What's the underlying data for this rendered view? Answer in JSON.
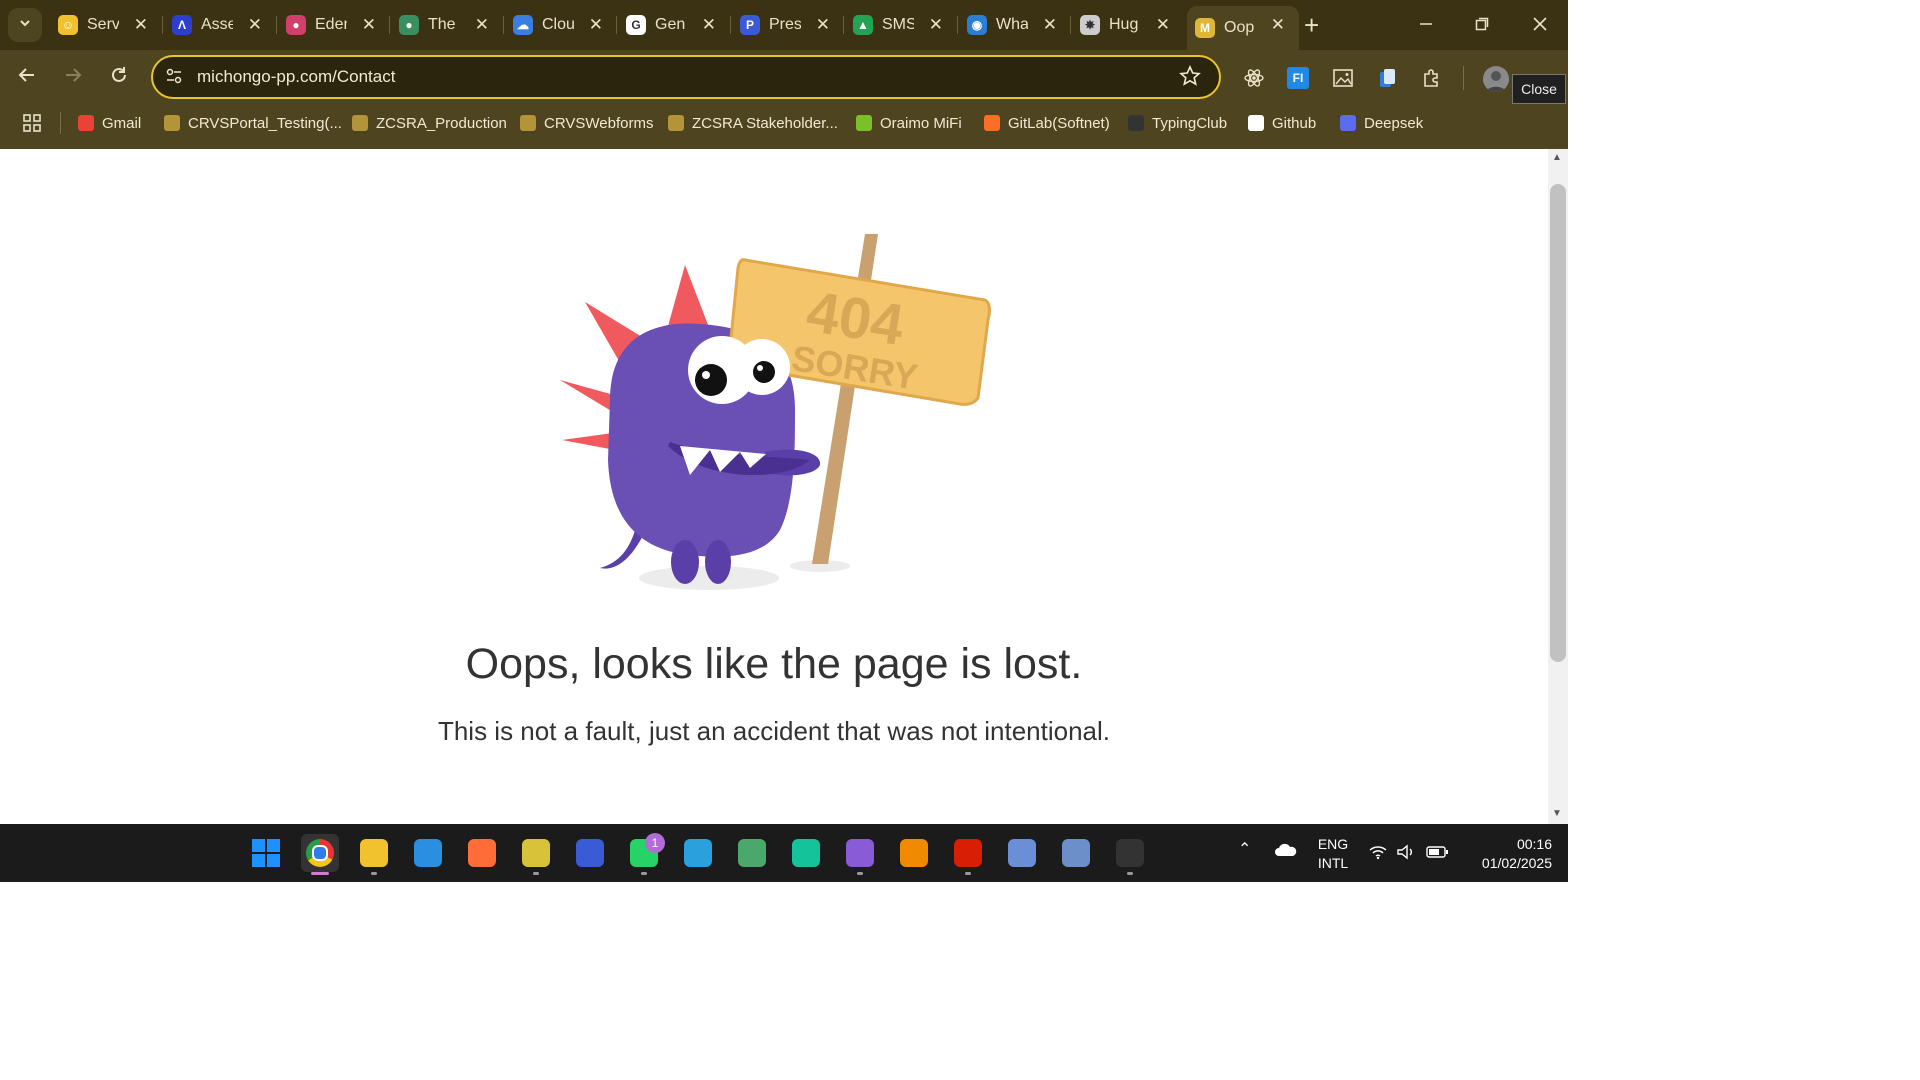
{
  "tabs": [
    {
      "title": "Serv",
      "fav_color": "#f2c12e",
      "fav_glyph": "☺"
    },
    {
      "title": "Asse",
      "fav_color": "#2d3fcf",
      "fav_glyph": "Λ"
    },
    {
      "title": "Eden",
      "fav_color": "#d23f6c",
      "fav_glyph": "●"
    },
    {
      "title": "The",
      "fav_color": "#3a8f61",
      "fav_glyph": "●"
    },
    {
      "title": "Clou",
      "fav_color": "#3a7ee0",
      "fav_glyph": "☁"
    },
    {
      "title": "Gen",
      "fav_color": "#ffffff",
      "fav_glyph": "G"
    },
    {
      "title": "Pres",
      "fav_color": "#3b5bd6",
      "fav_glyph": "P"
    },
    {
      "title": "SMS",
      "fav_color": "#23a455",
      "fav_glyph": "▲"
    },
    {
      "title": "Wha",
      "fav_color": "#2a7fd4",
      "fav_glyph": "◉"
    },
    {
      "title": "Hug",
      "fav_color": "#cccccc",
      "fav_glyph": "✸"
    },
    {
      "title": "Oop",
      "fav_color": "#e0b63a",
      "fav_glyph": "M"
    }
  ],
  "address": {
    "url": "michongo-pp.com/Contact"
  },
  "bookmarks": [
    {
      "label": "Gmail",
      "color": "#ea4335"
    },
    {
      "label": "CRVSPortal_Testing(...",
      "color": "#b3943a"
    },
    {
      "label": "ZCSRA_Production",
      "color": "#b3943a"
    },
    {
      "label": "CRVSWebforms",
      "color": "#b3943a"
    },
    {
      "label": "ZCSRA Stakeholder...",
      "color": "#b3943a"
    },
    {
      "label": "Oraimo MiFi",
      "color": "#7bbf2a"
    },
    {
      "label": "GitLab(Softnet)",
      "color": "#fc6d26"
    },
    {
      "label": "TypingClub",
      "color": "#333333"
    },
    {
      "label": "Github",
      "color": "#ffffff"
    },
    {
      "label": "Deepsek",
      "color": "#5b6cf0"
    }
  ],
  "tooltip": "Close",
  "page": {
    "sign_line1": "404",
    "sign_line2": "SORRY",
    "headline": "Oops, looks like the page is lost.",
    "subline": "This is not a fault, just an accident that was not intentional."
  },
  "taskbar": {
    "apps": [
      {
        "name": "windows-start",
        "color": "#1e90ff"
      },
      {
        "name": "chrome",
        "color": "#e44"
      },
      {
        "name": "file-explorer",
        "color": "#f2c12e"
      },
      {
        "name": "vscode",
        "color": "#2a8fe0"
      },
      {
        "name": "postman",
        "color": "#ff6c37"
      },
      {
        "name": "editor",
        "color": "#d8c23a"
      },
      {
        "name": "azure-data-studio",
        "color": "#3a5bd6"
      },
      {
        "name": "whatsapp",
        "color": "#25d366"
      },
      {
        "name": "telegram",
        "color": "#2aa0dc"
      },
      {
        "name": "globe",
        "color": "#4aa86c"
      },
      {
        "name": "grammarly",
        "color": "#15c39a"
      },
      {
        "name": "visual-studio",
        "color": "#8a5bd6"
      },
      {
        "name": "vlc",
        "color": "#f08a00"
      },
      {
        "name": "acrobat",
        "color": "#d81e05"
      },
      {
        "name": "files",
        "color": "#6b8fd6"
      },
      {
        "name": "postgres",
        "color": "#6d8fc9"
      },
      {
        "name": "terminal",
        "color": "#333"
      }
    ],
    "whatsapp_badge": "1",
    "lang_line1": "ENG",
    "lang_line2": "INTL",
    "time": "00:16",
    "date": "01/02/2025"
  }
}
